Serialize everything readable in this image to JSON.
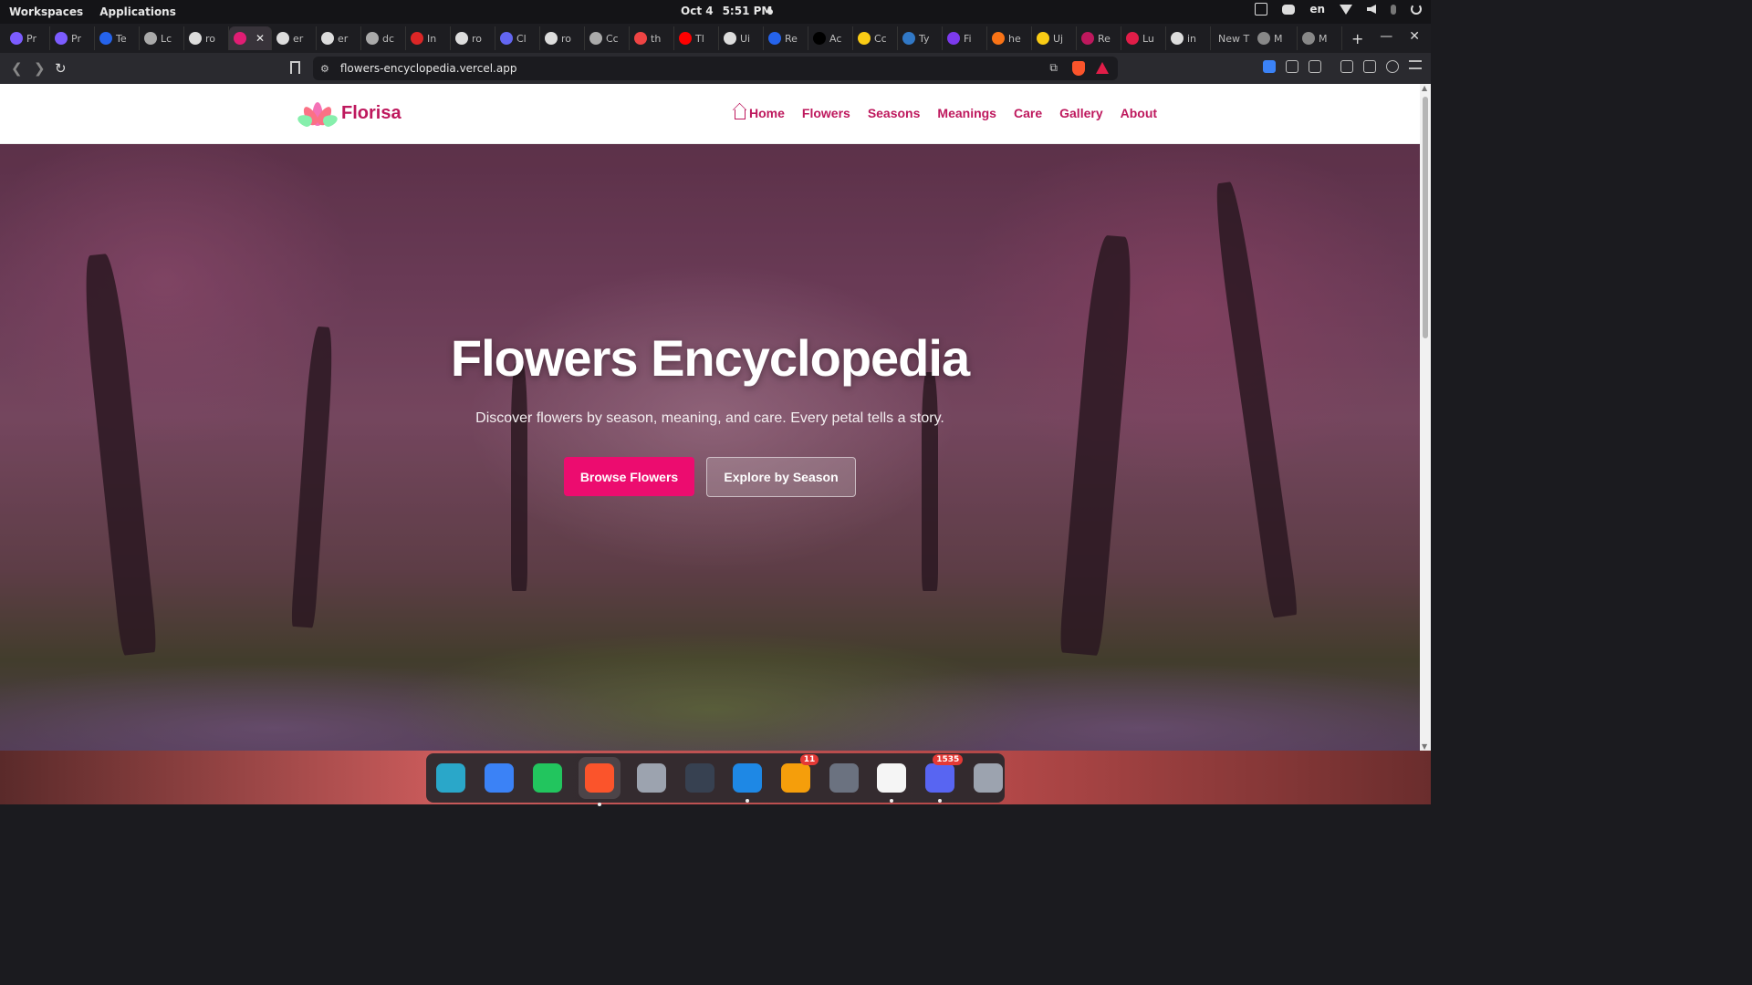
{
  "system_bar": {
    "workspaces": "Workspaces",
    "applications": "Applications",
    "date": "Oct 4",
    "time": "5:51 PM",
    "language": "en"
  },
  "tabs": [
    {
      "label": "Pr",
      "icon": "perplexity-icon",
      "color": "#7c5cff"
    },
    {
      "label": "Pr",
      "icon": "perplexity-icon",
      "color": "#7c5cff"
    },
    {
      "label": "Te",
      "icon": "app-icon",
      "color": "#2563eb"
    },
    {
      "label": "Lc",
      "icon": "openai-icon",
      "color": "#aaaaaa"
    },
    {
      "label": "ro",
      "icon": "github-icon",
      "color": "#dddddd"
    },
    {
      "label": "",
      "icon": "flower-icon",
      "color": "#e11d74",
      "active": true
    },
    {
      "label": "er",
      "icon": "github-icon",
      "color": "#dddddd"
    },
    {
      "label": "er",
      "icon": "github-icon",
      "color": "#dddddd"
    },
    {
      "label": "dc",
      "icon": "globe-icon",
      "color": "#aaaaaa"
    },
    {
      "label": "In",
      "icon": "app-icon",
      "color": "#dc2626"
    },
    {
      "label": "ro",
      "icon": "github-icon",
      "color": "#dddddd"
    },
    {
      "label": "Cl",
      "icon": "app-icon",
      "color": "#6366f1"
    },
    {
      "label": "ro",
      "icon": "github-icon",
      "color": "#dddddd"
    },
    {
      "label": "Cc",
      "icon": "globe-icon",
      "color": "#aaaaaa"
    },
    {
      "label": "th",
      "icon": "app-icon",
      "color": "#ef4444"
    },
    {
      "label": "Tl",
      "icon": "youtube-icon",
      "color": "#ff0000"
    },
    {
      "label": "Ui",
      "icon": "github-icon",
      "color": "#dddddd"
    },
    {
      "label": "Re",
      "icon": "app-icon",
      "color": "#2563eb"
    },
    {
      "label": "Ac",
      "icon": "app-icon",
      "color": "#000000"
    },
    {
      "label": "Cc",
      "icon": "app-icon",
      "color": "#facc15"
    },
    {
      "label": "Ty",
      "icon": "typescript-icon",
      "color": "#3178c6"
    },
    {
      "label": "Fi",
      "icon": "app-icon",
      "color": "#7c3aed"
    },
    {
      "label": "he",
      "icon": "app-icon",
      "color": "#f97316"
    },
    {
      "label": "Uj",
      "icon": "app-icon",
      "color": "#facc15"
    },
    {
      "label": "Re",
      "icon": "app-icon",
      "color": "#be185d"
    },
    {
      "label": "Lu",
      "icon": "app-icon",
      "color": "#e11d48"
    },
    {
      "label": "in",
      "icon": "github-icon",
      "color": "#dddddd"
    }
  ],
  "tabs_tail": {
    "new_tab": "New T",
    "m1": "M",
    "m2": "M"
  },
  "address": {
    "url": "flowers-encyclopedia.vercel.app"
  },
  "site": {
    "brand": "Florisa",
    "nav": [
      "Home",
      "Flowers",
      "Seasons",
      "Meanings",
      "Care",
      "Gallery",
      "About"
    ],
    "hero": {
      "title": "Flowers Encyclopedia",
      "subtitle": "Discover flowers by season, meaning, and care. Every petal tells a story.",
      "primary_button": "Browse Flowers",
      "secondary_button": "Explore by Season"
    },
    "colors": {
      "brand": "#be185d",
      "primary_button": "#ec0c6f"
    }
  },
  "dock": [
    {
      "name": "search-app-icon"
    },
    {
      "name": "screenshot-app-icon"
    },
    {
      "name": "app-grid-icon"
    },
    {
      "name": "brave-browser-icon",
      "active": true
    },
    {
      "name": "files-icon"
    },
    {
      "name": "terminal-icon"
    },
    {
      "name": "vscode-icon"
    },
    {
      "name": "software-updater-icon",
      "badge": "11"
    },
    {
      "name": "settings-icon"
    },
    {
      "name": "writer-app-icon"
    },
    {
      "name": "discord-icon",
      "badge": "1535"
    },
    {
      "name": "screenshot-tool-icon"
    }
  ]
}
